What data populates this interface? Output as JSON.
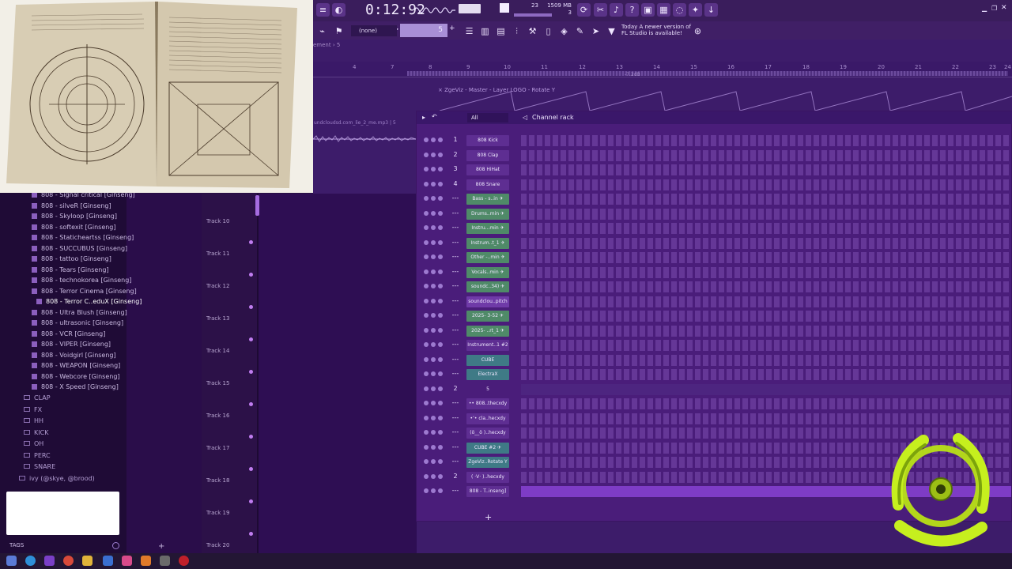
{
  "transport": {
    "time": "0:12:92",
    "cpu_top": "23",
    "memory": "1509 MB",
    "cpu_bottom": "3"
  },
  "toolbar": {
    "pattern": "(none)",
    "pattern_number": "5",
    "news_line1": "Today  A newer version of",
    "news_line2": "FL Studio is available!"
  },
  "playlist": {
    "breadcrumb": "ement › 5",
    "bars": [
      "4",
      "7",
      "8",
      "9",
      "10",
      "11",
      "12",
      "13",
      "14",
      "15",
      "16",
      "17",
      "18",
      "19",
      "20",
      "21",
      "22",
      "23",
      "24"
    ],
    "db_label": "-7.2dB",
    "automation_label": "× ZgeViz - Master - Layer LOGO - Rotate Y",
    "clip_name": "undcloudsd.com_lie_2_me.mp3 | 5",
    "tracks": [
      "Track 10",
      "Track 11",
      "Track 12",
      "Track 13",
      "Track 14",
      "Track 15",
      "Track 16",
      "Track 17",
      "Track 18",
      "Track 19",
      "Track 20"
    ]
  },
  "browser": {
    "items": [
      "808 - Signal critical [Ginseng]",
      "808 - silveR [Ginseng]",
      "808 - Skyloop [Ginseng]",
      "808 - softexit [Ginseng]",
      "808 - Staticheartss [Ginseng]",
      "808 - SUCCUBUS [Ginseng]",
      "808 - tattoo [Ginseng]",
      "808 - Tears [Ginseng]",
      "808 - technokorea [Ginseng]",
      "808 - Terror Cinema [Ginseng]",
      "808 - Terror C..eduX [Ginseng]",
      "808 - Ultra Blush [Ginseng]",
      "808 - ultrasonic [Ginseng]",
      "808 - VCR [Ginseng]",
      "808 - VIPER [Ginseng]",
      "808 - Voidgirl [Ginseng]",
      "808 - WEAPON [Ginseng]",
      "808 - Webcore [Ginseng]",
      "808 - X Speed [Ginseng]"
    ],
    "folders": [
      "CLAP",
      "FX",
      "HH",
      "KICK",
      "OH",
      "PERC",
      "SNARE"
    ],
    "root_folder": "ivy (@skye, @brood)",
    "tags_label": "TAGS",
    "plus": "+"
  },
  "channel_rack": {
    "title": "Channel rack",
    "filter": "All",
    "add": "+",
    "channels": [
      {
        "num": "1",
        "name": "808 Kick",
        "style": "plain"
      },
      {
        "num": "2",
        "name": "808 Clap",
        "style": "plain"
      },
      {
        "num": "3",
        "name": "808 HiHat",
        "style": "plain"
      },
      {
        "num": "4",
        "name": "808 Snare",
        "style": "plain"
      },
      {
        "num": "---",
        "name": "Bass - s..in ✈",
        "style": "green"
      },
      {
        "num": "---",
        "name": "Drums..min ✈",
        "style": "green"
      },
      {
        "num": "---",
        "name": "Instru...min ✈",
        "style": "green"
      },
      {
        "num": "---",
        "name": "Instrum..t_1 ✈",
        "style": "green"
      },
      {
        "num": "---",
        "name": "Other -..min ✈",
        "style": "green"
      },
      {
        "num": "---",
        "name": "Vocals..min ✈",
        "style": "green"
      },
      {
        "num": "---",
        "name": "soundc..34) ✈",
        "style": "green"
      },
      {
        "num": "---",
        "name": "soundclou..pitch",
        "style": "purple2"
      },
      {
        "num": "---",
        "name": "2025- 3-52 ✈",
        "style": "green"
      },
      {
        "num": "---",
        "name": "2025- ..rt_1 ✈",
        "style": "green"
      },
      {
        "num": "---",
        "name": "Instrument..1 #2",
        "style": "plain"
      },
      {
        "num": "---",
        "name": "CUBE",
        "style": "teal"
      },
      {
        "num": "---",
        "name": "ElectraX",
        "style": "teal"
      },
      {
        "num": "2",
        "name": "5",
        "style": "none"
      },
      {
        "num": "---",
        "name": "•• 808..thecxdy",
        "style": "plain"
      },
      {
        "num": "---",
        "name": "•‘• cla..hecxdy",
        "style": "plain"
      },
      {
        "num": "---",
        "name": "(ö__ö )..hecxdy",
        "style": "plain"
      },
      {
        "num": "---",
        "name": "CUBE #2 ✈",
        "style": "teal"
      },
      {
        "num": "---",
        "name": "ZgeViz..Rotate Y",
        "style": "teal"
      },
      {
        "num": "2",
        "name": "( ·V· )..hecxdy",
        "style": "plain"
      },
      {
        "num": "---",
        "name": "808 - T..inseng]",
        "style": "plain"
      }
    ]
  },
  "colors": {
    "background": "#2a0f45",
    "rack": "#4a1d7a",
    "accent": "#7e3cc6",
    "biohazard": "#b8e016"
  }
}
